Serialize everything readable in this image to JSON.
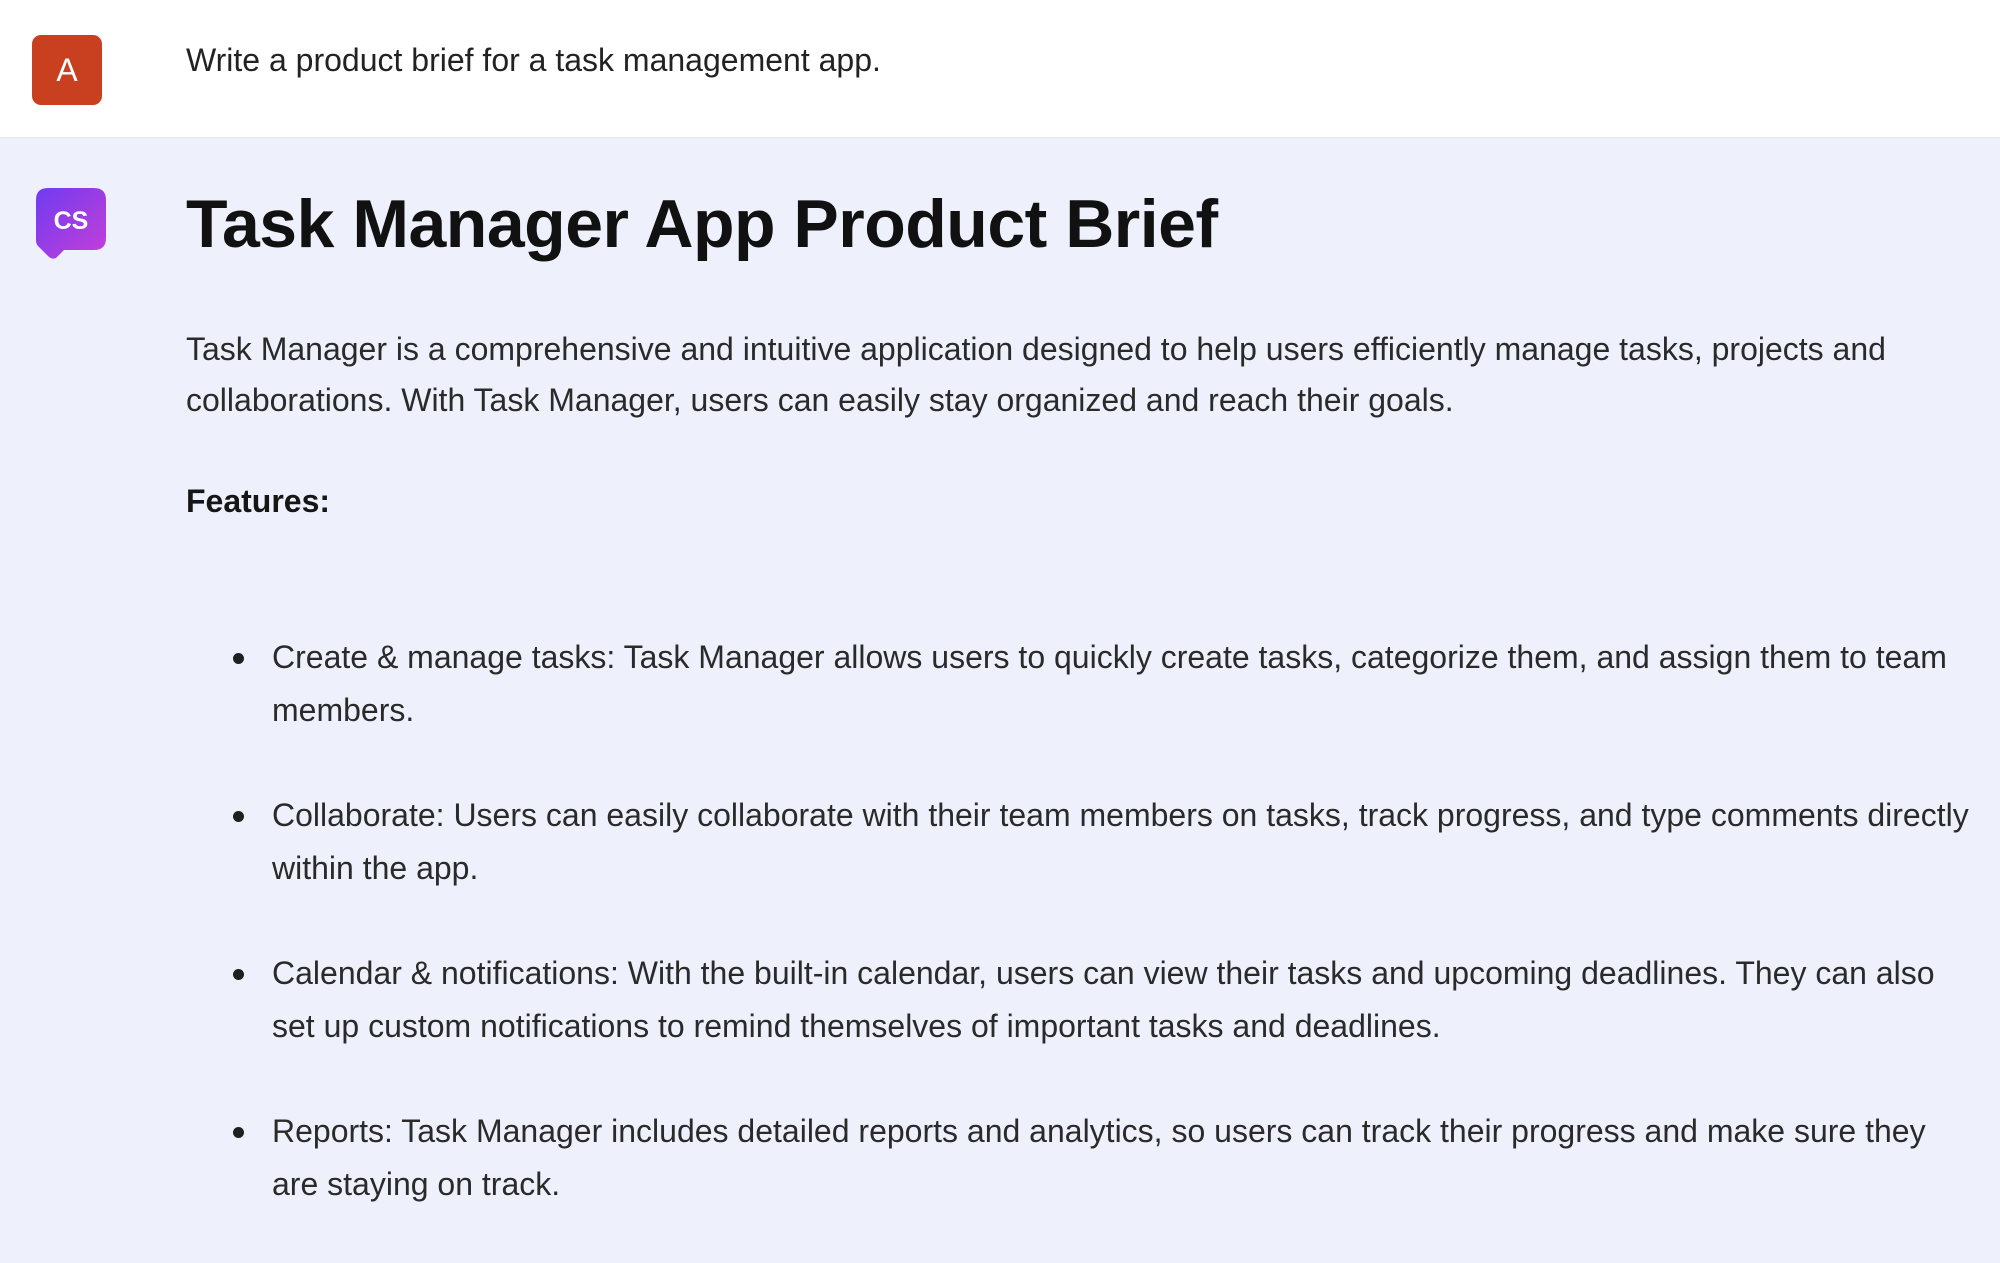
{
  "conversation": {
    "user": {
      "avatar_initial": "A",
      "avatar_color": "#c8401f",
      "message": "Write a product brief for a task management app."
    },
    "assistant": {
      "avatar_initials": "CS",
      "avatar_gradient": [
        "#7b3ff2",
        "#c23ddc"
      ],
      "title": "Task Manager App Product Brief",
      "intro": "Task Manager is a comprehensive and intuitive application designed to help users efficiently manage tasks, projects and collaborations. With Task Manager, users can easily stay organized and reach their goals.",
      "features_heading": "Features:",
      "features": [
        "Create & manage tasks: Task Manager allows users to quickly create tasks, categorize them, and assign them to team members.",
        "Collaborate: Users can easily collaborate with their team members on tasks, track progress, and type comments directly within the app.",
        "Calendar & notifications: With the built-in calendar, users can view their tasks and upcoming deadlines. They can also set up custom notifications to remind themselves of important tasks and deadlines.",
        "Reports: Task Manager includes detailed reports and analytics, so users can track their progress and make sure they are staying on track."
      ]
    }
  }
}
